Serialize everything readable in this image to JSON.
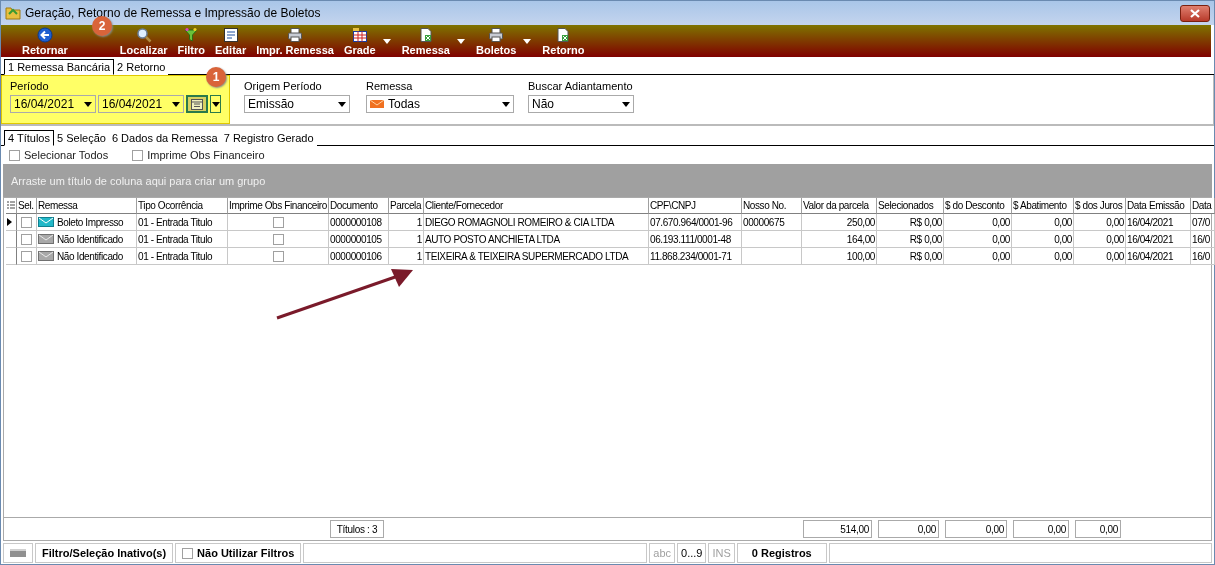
{
  "window": {
    "title": "Geração, Retorno de Remessa e Impressão de Boletos"
  },
  "toolbar": [
    {
      "label": "Retornar",
      "kind": "back",
      "menu": false
    },
    {
      "label": "Localizar",
      "kind": "search",
      "menu": false
    },
    {
      "label": "Filtro",
      "kind": "funnel",
      "menu": false
    },
    {
      "label": "Editar",
      "kind": "edit",
      "menu": false
    },
    {
      "label": "Impr. Remessa",
      "kind": "printer",
      "menu": false
    },
    {
      "label": "Grade",
      "kind": "grid",
      "menu": true
    },
    {
      "label": "Remessa",
      "kind": "document",
      "menu": true
    },
    {
      "label": "Boletos",
      "kind": "printer",
      "menu": true
    },
    {
      "label": "Retorno",
      "kind": "document",
      "menu": false
    }
  ],
  "tabs": [
    {
      "label": "1 Remessa Bancária",
      "selected": true
    },
    {
      "label": "2 Retorno",
      "selected": false
    }
  ],
  "filters": {
    "periodo": {
      "label": "Período",
      "from": "16/04/2021",
      "to": "16/04/2021"
    },
    "origem": {
      "label": "Origem Período",
      "value": "Emissão"
    },
    "remessa": {
      "label": "Remessa",
      "value": "Todas"
    },
    "adiantamento": {
      "label": "Buscar Adiantamento",
      "value": "Não"
    }
  },
  "subtabs": [
    {
      "label": "4 Títulos",
      "selected": true
    },
    {
      "label": "5 Seleção",
      "selected": false
    },
    {
      "label": "6 Dados da Remessa",
      "selected": false
    },
    {
      "label": "7 Registro Gerado",
      "selected": false
    }
  ],
  "options": [
    {
      "label": "Selecionar Todos",
      "checked": false
    },
    {
      "label": "Imprime Obs Financeiro",
      "checked": false
    }
  ],
  "group_hint": "Arraste um título de coluna aqui para criar um grupo",
  "columns": [
    {
      "label": "Sel.",
      "kind": "check"
    },
    {
      "label": "Remessa",
      "kind": "status"
    },
    {
      "label": "Tipo Ocorrência",
      "kind": "text"
    },
    {
      "label": "Imprime Obs Financeiro",
      "kind": "obs"
    },
    {
      "label": "Documento",
      "kind": "text",
      "total": "Títulos : 3"
    },
    {
      "label": "Parcela",
      "kind": "num"
    },
    {
      "label": "Cliente/Fornecedor",
      "kind": "text"
    },
    {
      "label": "CPF\\CNPJ",
      "kind": "text"
    },
    {
      "label": "Nosso No.",
      "kind": "text"
    },
    {
      "label": "Valor da parcela",
      "kind": "num",
      "total": "514,00"
    },
    {
      "label": "Selecionados",
      "kind": "num",
      "total": "0,00"
    },
    {
      "label": "$ do Desconto",
      "kind": "num",
      "total": "0,00"
    },
    {
      "label": "$ Abatimento",
      "kind": "num",
      "total": "0,00"
    },
    {
      "label": "$ dos Juros",
      "kind": "num",
      "total": "0,00"
    },
    {
      "label": "Data Emissão",
      "kind": "text"
    },
    {
      "label": "Data",
      "kind": "text"
    }
  ],
  "rows": [
    {
      "current": true,
      "checked": false,
      "kind": "printed",
      "remessa": "Boleto Impresso",
      "obs": false,
      "cells": [
        "01 - Entrada Titulo",
        "0000000108",
        "1",
        "DIEGO ROMAGNOLI ROMEIRO & CIA LTDA",
        "07.670.964/0001-96",
        "00000675",
        "250,00",
        "R$ 0,00",
        "0,00",
        "0,00",
        "0,00",
        "16/04/2021",
        "07/0"
      ]
    },
    {
      "current": false,
      "checked": false,
      "kind": "unidentified",
      "remessa": "Não Identificado",
      "obs": false,
      "cells": [
        "01 - Entrada Titulo",
        "0000000105",
        "1",
        "AUTO POSTO ANCHIETA LTDA",
        "06.193.111/0001-48",
        null,
        "164,00",
        "R$ 0,00",
        "0,00",
        "0,00",
        "0,00",
        "16/04/2021",
        "16/0"
      ]
    },
    {
      "current": false,
      "checked": false,
      "kind": "unidentified",
      "remessa": "Não Identificado",
      "obs": false,
      "cells": [
        "01 - Entrada Titulo",
        "0000000106",
        "1",
        "TEIXEIRA & TEIXEIRA SUPERMERCADO LTDA",
        "11.868.234/0001-71",
        null,
        "100,00",
        "R$ 0,00",
        "0,00",
        "0,00",
        "0,00",
        "16/04/2021",
        "16/0"
      ]
    }
  ],
  "status_bar": {
    "filter": "Filtro/Seleção Inativo(s)",
    "no_filters": {
      "label": "Não Utilizar Filtros",
      "checked": false
    },
    "indicators": [
      {
        "label": "abc",
        "disabled": true
      },
      {
        "label": "0...9",
        "disabled": false
      },
      {
        "label": "INS",
        "disabled": true
      }
    ],
    "records": "0 Registros"
  },
  "annotations": [
    {
      "number": "1"
    },
    {
      "number": "2"
    }
  ]
}
